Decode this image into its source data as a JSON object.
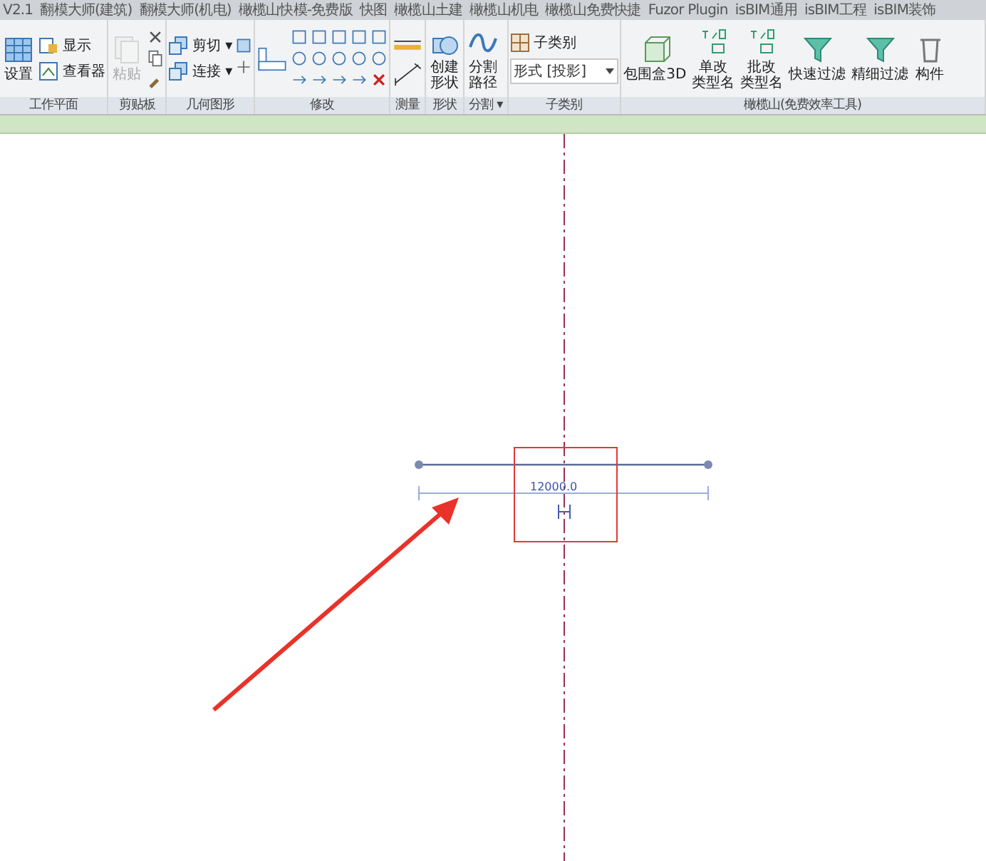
{
  "tabs": [
    "V2.1",
    "翻模大师(建筑)",
    "翻模大师(机电)",
    "橄榄山快模-免费版",
    "快图",
    "橄榄山土建",
    "橄榄山机电",
    "橄榄山免费快捷",
    "Fuzor Plugin",
    "isBIM通用",
    "isBIM工程",
    "isBIM装饰"
  ],
  "panels": [
    {
      "title": "工作平面",
      "tools": [
        {
          "kind": "large",
          "label": "设置",
          "disabled": false
        },
        {
          "kind": "small",
          "label": "显示",
          "disabled": false
        },
        {
          "kind": "small",
          "label": "查看器",
          "disabled": false
        }
      ]
    },
    {
      "title": "剪贴板",
      "tools": [
        {
          "kind": "large",
          "label": "粘贴",
          "disabled": true
        },
        {
          "kind": "icons",
          "disabled": false
        }
      ]
    },
    {
      "title": "几何图形",
      "tools": [
        {
          "kind": "small",
          "label": "剪切 ▾",
          "disabled": false
        },
        {
          "kind": "small",
          "label": "连接 ▾",
          "disabled": false
        },
        {
          "kind": "icons",
          "disabled": false
        }
      ]
    },
    {
      "title": "修改",
      "tools": [
        {
          "kind": "icons",
          "disabled": false
        }
      ]
    },
    {
      "title": "测量",
      "tools": [
        {
          "kind": "icons",
          "disabled": false
        }
      ]
    },
    {
      "title": "形状",
      "tools": [
        {
          "kind": "large",
          "lines": [
            "创建",
            "形状"
          ],
          "disabled": false
        }
      ]
    },
    {
      "title": "分割 ▾",
      "tools": [
        {
          "kind": "large",
          "lines": [
            "分割",
            "路径"
          ],
          "disabled": false
        }
      ]
    },
    {
      "title": "子类别",
      "tools": [
        {
          "kind": "small",
          "label": "子类别",
          "disabled": false
        },
        {
          "kind": "dropdown",
          "label": "形式 [投影]",
          "disabled": false
        }
      ]
    },
    {
      "title": "橄榄山(免费效率工具)",
      "tools": [
        {
          "kind": "large",
          "label": "包围盒3D",
          "disabled": false
        },
        {
          "kind": "large",
          "lines": [
            "单改",
            "类型名"
          ],
          "disabled": false
        },
        {
          "kind": "large",
          "lines": [
            "批改",
            "类型名"
          ],
          "disabled": false
        },
        {
          "kind": "large",
          "label": "快速过滤",
          "disabled": false
        },
        {
          "kind": "large",
          "label": "精细过滤",
          "disabled": false
        },
        {
          "kind": "large",
          "label": "构件",
          "disabled": false
        }
      ]
    }
  ],
  "canvas": {
    "dimension": "12000.0"
  }
}
